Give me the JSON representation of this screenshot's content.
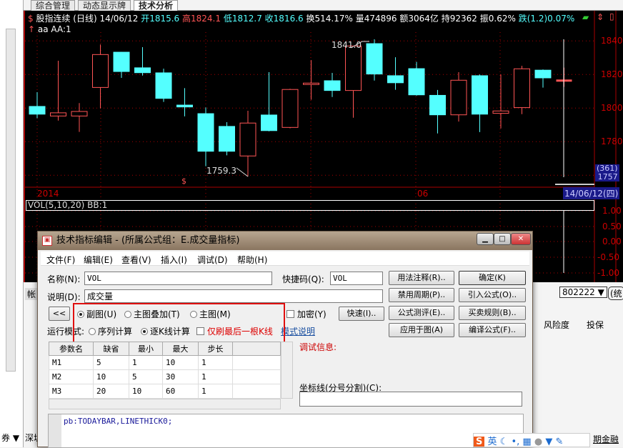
{
  "tabs": [
    {
      "label": "综合管理"
    },
    {
      "label": "动态显示牌"
    },
    {
      "label": "技术分析"
    }
  ],
  "header": {
    "name": "股指连续 (日线) 14/06/12",
    "open": "开1815.6",
    "high": "高1824.1",
    "low": "低1812.7",
    "close": "收1816.6",
    "turnover": "换514.17%",
    "volume": "量474896",
    "amount": "额3064亿",
    "hold": "持92362",
    "amp": "振0.62%",
    "change": "跌(1.2)0.07%",
    "line2": "aa AA:1"
  },
  "chart_annotations": {
    "high_label": "1841.0",
    "low_label": "1759.3",
    "year_label": "2014",
    "month_label": "06",
    "cursor_count": "(361)",
    "cursor_price": "1757",
    "cursor_date": "14/06/12(四)"
  },
  "price_axis": [
    "1840",
    "1820",
    "1800",
    "1780"
  ],
  "vol": {
    "title": "VOL(5,10,20) BB:1",
    "axis": [
      "1.00",
      "0.50",
      "0.00",
      "-0.50",
      "-1.00"
    ]
  },
  "colors": {
    "up": "#ff5555",
    "down": "#54ffff",
    "grid": "#aa0000"
  },
  "chart_data": {
    "type": "candlestick",
    "ylim": [
      1755,
      1845
    ],
    "candles": [
      [
        1801,
        1809.5,
        1794,
        1796.4
      ],
      [
        1795.3,
        1828.2,
        1792.6,
        1797.2
      ],
      [
        1795.3,
        1803,
        1785.8,
        1798
      ],
      [
        1812.3,
        1837.9,
        1799.8,
        1831.9
      ],
      [
        1833.3,
        1833.5,
        1818,
        1821.8
      ],
      [
        1824,
        1836.3,
        1819.4,
        1821.1
      ],
      [
        1821,
        1823.5,
        1803.7,
        1805.8
      ],
      [
        1801.8,
        1811.9,
        1795.1,
        1800.7
      ],
      [
        1796.7,
        1800.4,
        1765.4,
        1774.3
      ],
      [
        1789.1,
        1791.6,
        1771.9,
        1774.3
      ],
      [
        1771.5,
        1798.4,
        1759.3,
        1791.1
      ],
      [
        1795.9,
        1821.4,
        1786.2,
        1786.6
      ],
      [
        1788.5,
        1811.5,
        1788,
        1811.1
      ],
      [
        1814.5,
        1828.6,
        1805,
        1814.9
      ],
      [
        1816.3,
        1821,
        1806.6,
        1810.5
      ],
      [
        1810.5,
        1837,
        1794.3,
        1837
      ],
      [
        1838.4,
        1841,
        1816.4,
        1820.3
      ],
      [
        1819.3,
        1830.3,
        1810.9,
        1815.1
      ],
      [
        1823.5,
        1827.5,
        1807.4,
        1807.9
      ],
      [
        1807.6,
        1810.8,
        1784.9,
        1796
      ],
      [
        1796,
        1821.4,
        1792,
        1816.6
      ],
      [
        1819.3,
        1820,
        1785.7,
        1796.4
      ],
      [
        1796.9,
        1820,
        1787.9,
        1798.3
      ],
      [
        1800.3,
        1825.2,
        1796.4,
        1823.4
      ],
      [
        1822.6,
        1823,
        1812.2,
        1818
      ],
      [
        1815.6,
        1824.1,
        1812.7,
        1816.6
      ]
    ]
  },
  "lower": {
    "tab": "帐",
    "account": "802222",
    "stat_btn": "(统",
    "col1": "风险度",
    "col2": "投保",
    "bottom_left": "券 ▼",
    "bottom_tab": "深圳",
    "bottom_right": "期金融"
  },
  "dialog": {
    "title": "技术指标编辑 - (所属公式组：E.成交量指标)",
    "menu": [
      "文件(F)",
      "编辑(E)",
      "查看(V)",
      "插入(I)",
      "调试(D)",
      "帮助(H)"
    ],
    "name_label": "名称(N):",
    "name_value": "VOL",
    "shortcut_label": "快捷码(Q):",
    "shortcut_value": "VOL",
    "desc_label": "说明(D):",
    "desc_value": "成交量",
    "collapse": "<<",
    "radio_sub": "副图(U)",
    "radio_overlay": "主图叠加(T)",
    "radio_main": "主图(M)",
    "encrypt": "加密(Y)",
    "quick": "快速(I)..",
    "mode_label": "运行模式:",
    "mode_seq": "序列计算",
    "mode_bar": "逐K线计算",
    "last_bar": "仅刷最后一根K线",
    "mode_help": "模式说明",
    "buttons": [
      "用法注释(R)..",
      "确定(K)",
      "禁用周期(P)..",
      "引入公式(O)..",
      "公式测评(E)..",
      "买卖规则(B)..",
      "应用于图(A)",
      "编译公式(F).."
    ],
    "params_headers": [
      "参数名",
      "缺省",
      "最小",
      "最大",
      "步长"
    ],
    "params": [
      [
        "M1",
        "5",
        "1",
        "10",
        "1"
      ],
      [
        "M2",
        "10",
        "5",
        "30",
        "1"
      ],
      [
        "M3",
        "20",
        "10",
        "60",
        "1"
      ]
    ],
    "debug_label": "调试信息:",
    "axis_label": "坐标线(分号分割)(C):",
    "code": "pb:TODAYBAR,LINETHICK0;"
  },
  "ime": {
    "lang": "英"
  }
}
